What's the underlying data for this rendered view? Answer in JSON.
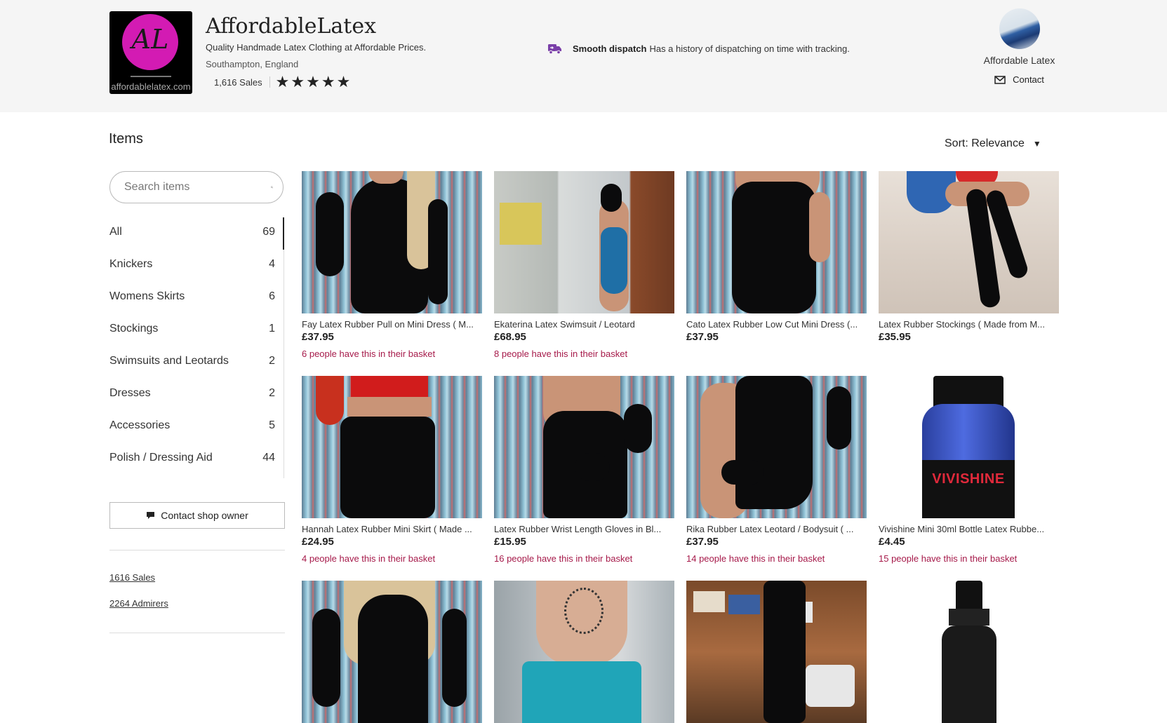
{
  "shop": {
    "logo_mark": "AL",
    "logo_url_text": "affordablelatex.com",
    "name": "AffordableLatex",
    "tagline": "Quality Handmade Latex Clothing at Affordable Prices.",
    "location": "Southampton, England",
    "sales": "1,616 Sales",
    "rating_stars": 5
  },
  "dispatch": {
    "title": "Smooth dispatch",
    "text": "Has a history of dispatching on time with tracking.",
    "icon": "truck-icon"
  },
  "owner": {
    "name": "Affordable Latex",
    "contact_label": "Contact",
    "icon": "envelope-icon"
  },
  "items": {
    "title": "Items",
    "sort_label": "Sort: Relevance",
    "search_placeholder": "Search items"
  },
  "categories": [
    {
      "label": "All",
      "count": "69"
    },
    {
      "label": "Knickers",
      "count": "4"
    },
    {
      "label": "Womens Skirts",
      "count": "6"
    },
    {
      "label": "Stockings",
      "count": "1"
    },
    {
      "label": "Swimsuits and Leotards",
      "count": "2"
    },
    {
      "label": "Dresses",
      "count": "2"
    },
    {
      "label": "Accessories",
      "count": "5"
    },
    {
      "label": "Polish / Dressing Aid",
      "count": "44"
    }
  ],
  "sidebar": {
    "contact_owner_label": "Contact shop owner",
    "sales_link": "1616 Sales",
    "admirers_link": "2264 Admirers"
  },
  "listings": [
    {
      "title": "Fay Latex Rubber Pull on Mini Dress ( M...",
      "price": "£37.95",
      "basket": "6 people have this in their basket"
    },
    {
      "title": "Ekaterina Latex Swimsuit / Leotard",
      "price": "£68.95",
      "basket": "8 people have this in their basket"
    },
    {
      "title": "Cato Latex Rubber Low Cut Mini Dress (...",
      "price": "£37.95",
      "basket": ""
    },
    {
      "title": "Latex Rubber Stockings ( Made from M...",
      "price": "£35.95",
      "basket": ""
    },
    {
      "title": "Hannah Latex Rubber Mini Skirt ( Made ...",
      "price": "£24.95",
      "basket": "4 people have this in their basket"
    },
    {
      "title": "Latex Rubber Wrist Length Gloves in Bl...",
      "price": "£15.95",
      "basket": "16 people have this in their basket"
    },
    {
      "title": "Rika Rubber Latex Leotard / Bodysuit ( ...",
      "price": "£37.95",
      "basket": "14 people have this in their basket"
    },
    {
      "title": "Vivishine Mini 30ml Bottle Latex Rubbe...",
      "price": "£4.45",
      "basket": "15 people have this in their basket"
    }
  ],
  "product_labels": {
    "vivishine": "VIVISHINE"
  },
  "colors": {
    "header_bg": "#f5f5f5",
    "basket_text": "#a61a4a",
    "logo_circle": "#d31bb3"
  }
}
